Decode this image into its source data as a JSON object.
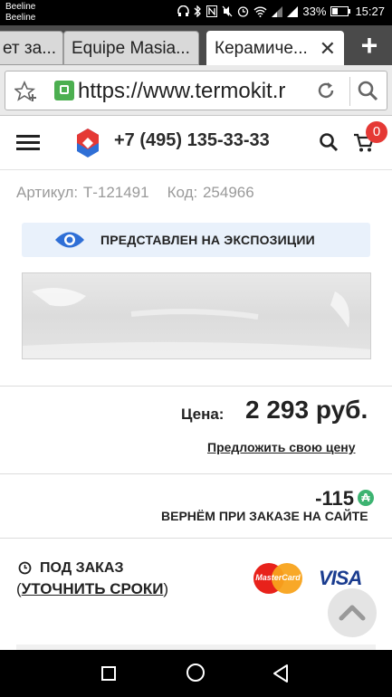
{
  "status_bar": {
    "carrier_1": "Beeline",
    "carrier_2": "Beeline",
    "battery": "33%",
    "time": "15:27"
  },
  "browser": {
    "tabs": [
      {
        "label": "ет за..."
      },
      {
        "label": "Equipe Masia..."
      },
      {
        "label": "Керамиче...",
        "active": true
      }
    ],
    "close_tab_glyph": "✕",
    "new_tab_glyph": "+",
    "url": "https://www.termokit.r"
  },
  "site_header": {
    "phone": "+7 (495) 135-33-33",
    "cart_count": "0"
  },
  "product": {
    "article": "Артикул: Т-121491",
    "code": "Код: 254966",
    "exposition_label": "ПРЕДСТАВЛЕН НА ЭКСПОЗИЦИИ",
    "price_label": "Цена:",
    "price_value": "2 293 руб.",
    "offer_link": "Предложить свою цену",
    "bonus_value": "-115",
    "bonus_icon": "₳",
    "bonus_text": "ВЕРНЁМ ПРИ ЗАКАЗЕ НА САЙТЕ",
    "availability_title": "ПОД ЗАКАЗ",
    "availability_open": "(",
    "availability_link": "УТОЧНИТЬ СРОКИ",
    "availability_close": ")"
  },
  "payment": {
    "mastercard": "MasterCard",
    "visa": "VISA"
  },
  "colors": {
    "accent_red": "#e53935",
    "expo_bg": "#e9f1fb",
    "eye_blue": "#2f6fd6",
    "bonus_green": "#3cb371"
  }
}
